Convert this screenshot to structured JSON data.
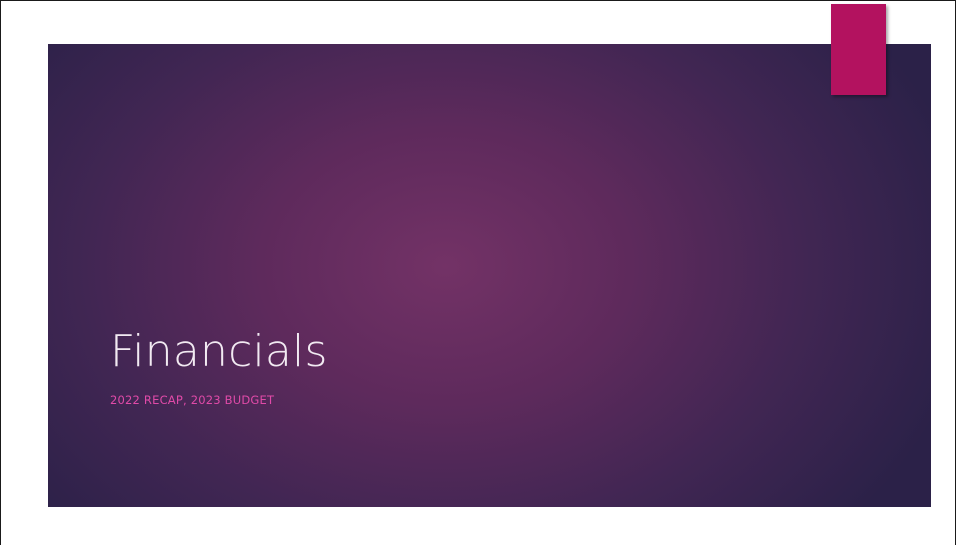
{
  "slide": {
    "title": "Financials",
    "subtitle": "2022 RECAP, 2023 BUDGET"
  },
  "colors": {
    "accent": "#b3125f",
    "subtitle": "#e04aa8",
    "background_center": "#733266",
    "background_edge": "#2b2148"
  }
}
